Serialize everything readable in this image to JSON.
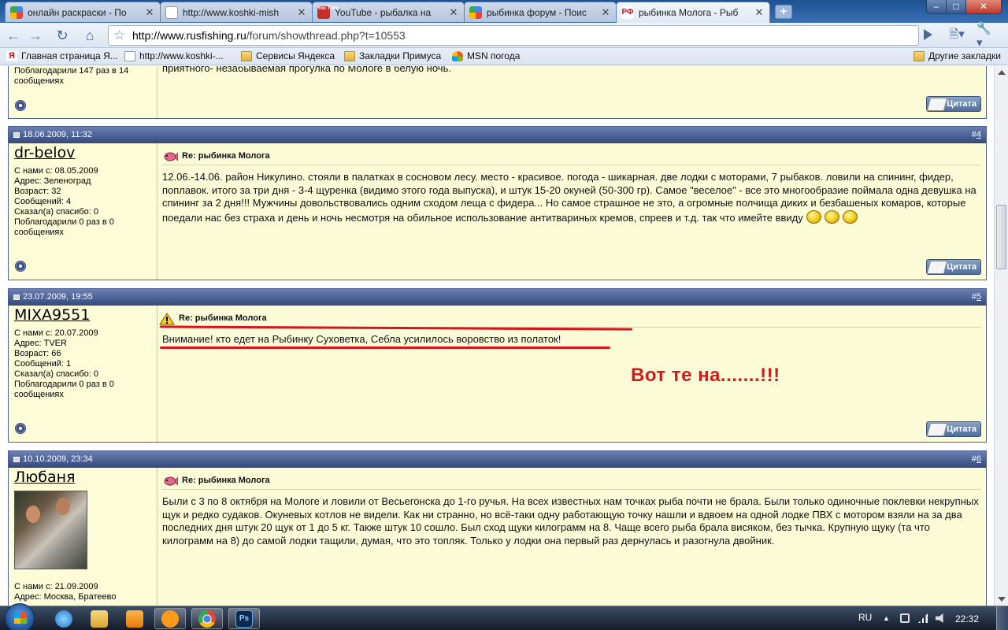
{
  "browser": {
    "tabs": [
      {
        "title": "онлайн раскраски - По",
        "favicon": "google",
        "active": false
      },
      {
        "title": "http://www.koshki-mish",
        "favicon": "page",
        "active": false
      },
      {
        "title": "YouTube - рыбалка на",
        "favicon": "youtube",
        "active": false
      },
      {
        "title": "рыбинка форум - Поис",
        "favicon": "google",
        "active": false
      },
      {
        "title": "рыбинка Молога - Рыб",
        "favicon": "rf",
        "active": true
      }
    ],
    "favicon_rf_text": "РФ",
    "favicon_youtube_text": "You Tube",
    "new_tab_label": "+",
    "window_buttons": {
      "minimize": "–",
      "maximize": "□",
      "close": "✕"
    },
    "url_host": "http://www.rusfishing.ru",
    "url_path": "/forum/showthread.php?t=10553"
  },
  "bookmarks": [
    {
      "label": "Главная страница Я...",
      "icon": "yandex-icon"
    },
    {
      "label": "http://www.koshki-...",
      "icon": "page-icon"
    },
    {
      "label": "Сервисы Яндекса",
      "icon": "folder-icon"
    },
    {
      "label": "Закладки Примуса",
      "icon": "folder-icon"
    },
    {
      "label": "MSN погода",
      "icon": "msn-icon"
    }
  ],
  "other_bookmarks": "Другие закладки",
  "forum": {
    "top_fragment": {
      "sidebar": "Поблагодарили 147 раз в 14 сообщениях",
      "body": "приятного- незабываемая прогулка по Мологе в белую ночь."
    },
    "quote_label": "Цитата",
    "posts": [
      {
        "date": "18.06.2009, 11:32",
        "number_prefix": "#",
        "number": "4",
        "username": "dr-belov",
        "info": [
          "С нами с: 08.05.2009",
          "Адрес: Зеленоград",
          "Возраст: 32",
          "Сообщений: 4",
          "Сказал(а) спасибо: 0",
          "Поблагодарили 0 раз в 0 сообщениях"
        ],
        "title": "Re: рыбинка Молога",
        "title_icon": "fish-icon",
        "body": "12.06.-14.06. район Никулино. стояли в палатках в сосновом лесу. место - красивое. погода - шикарная. две лодки с моторами, 7 рыбаков. ловили на спининг, фидер, поплавок. итого за три дня - 3-4 щуренка (видимо этого года выпуска), и штук 15-20 окуней (50-300 гр). Самое \"веселое\" - все это многообразие поймала одна девушка на спининг за 2 дня!!! Мужчины довольствовались одним сходом леща с фидера... Но самое страшное не это, а огромные полчища диких и безбашеных комаров, которые поедали нас без страха и день и ночь несмотря на обильное использование антитвариных кремов, спреев и т.д. так что имейте ввиду"
      },
      {
        "date": "23.07.2009, 19:55",
        "number_prefix": "#",
        "number": "5",
        "username": "MIXA9551",
        "info": [
          "С нами с: 20.07.2009",
          "Адрес: TVER",
          "Возраст: 66",
          "Сообщений: 1",
          "Сказал(а) спасибо: 0",
          "Поблагодарили 0 раз в 0 сообщениях"
        ],
        "title": "Re: рыбинка Молога",
        "title_icon": "warning-icon",
        "body": "Внимание! кто едет на Рыбинку Суховетка, Себла усилилось воровство из полаток!",
        "annotation": "Вот те на.......!!!"
      },
      {
        "date": "10.10.2009, 23:34",
        "number_prefix": "#",
        "number": "6",
        "username": "Любаня",
        "info": [
          "С нами с: 21.09.2009",
          "Адрес: Москва, Братеево"
        ],
        "title": "Re: рыбинка Молога",
        "title_icon": "fish-icon",
        "body": "Были с 3 по 8 октября на Мологе и ловили от Весьегонска до 1-го ручья. На всех известных нам точках рыба почти не брала. Были только одиночные поклевки некрупных щук и редко судаков. Окуневых котлов не видели. Как ни странно, но всё-таки одну работающую точку нашли и вдвоем на одной лодке ПВХ с мотором взяли на за два последних дня штук 20 щук от 1 до 5 кг. Также штук 10 сошло. Был сход щуки килограмм на 8. Чаще всего рыба брала висяком, без тычка. Крупную щуку (та что килограмм на 8) до самой лодки тащили, думая, что это топляк. Только у лодки она первый раз дернулась и разогнула двойник."
      }
    ]
  },
  "taskbar": {
    "apps": [
      "internet-explorer-icon",
      "explorer-folder-icon",
      "media-player-icon",
      "mail-agent-icon",
      "chrome-icon",
      "photoshop-icon"
    ],
    "photoshop_label": "Ps",
    "lang": "RU",
    "time": "22:32"
  },
  "colors": {
    "accent_red": "#d6161a",
    "post_header": "#34487c",
    "post_bg": "#fcfbd8"
  }
}
